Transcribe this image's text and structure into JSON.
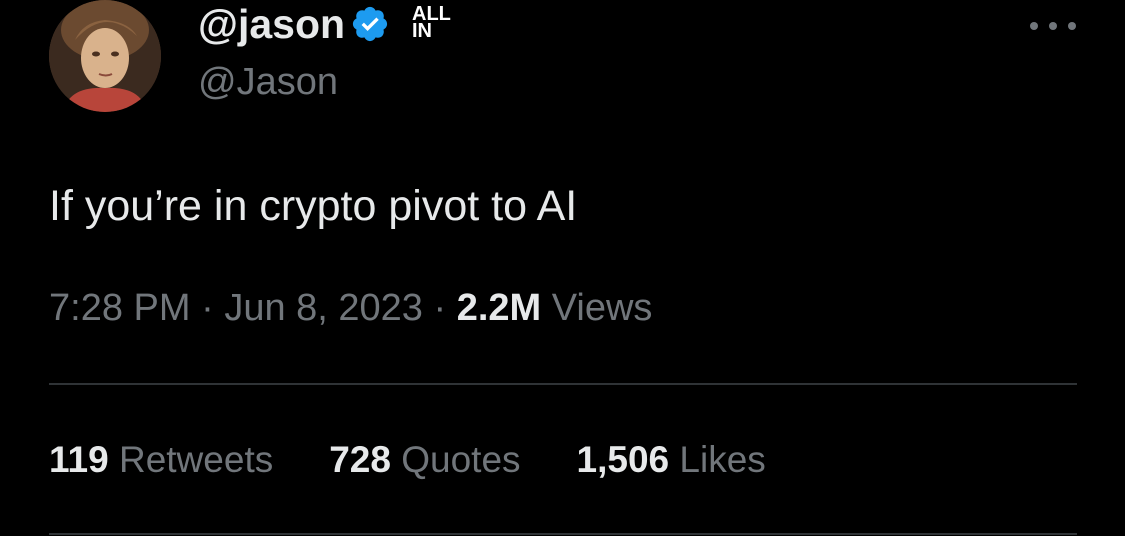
{
  "author": {
    "display_name": "@jason",
    "handle": "@Jason",
    "verified": true,
    "verified_color": "#1d9bf0",
    "affiliate_badge": [
      "ALL",
      "IN"
    ]
  },
  "tweet": {
    "text": "If you’re in crypto pivot to AI",
    "time": "7:28 PM",
    "date": "Jun 8, 2023",
    "separator": "·",
    "views_count": "2.2M",
    "views_label": "Views"
  },
  "stats": [
    {
      "count": "119",
      "label": "Retweets"
    },
    {
      "count": "728",
      "label": "Quotes"
    },
    {
      "count": "1,506",
      "label": "Likes"
    }
  ],
  "icons": {
    "more": "more-horizontal-icon",
    "verified": "verified-badge-icon"
  },
  "colors": {
    "background": "#000000",
    "primary_text": "#e7e9ea",
    "secondary_text": "#71767b",
    "divider": "#2f3336"
  }
}
